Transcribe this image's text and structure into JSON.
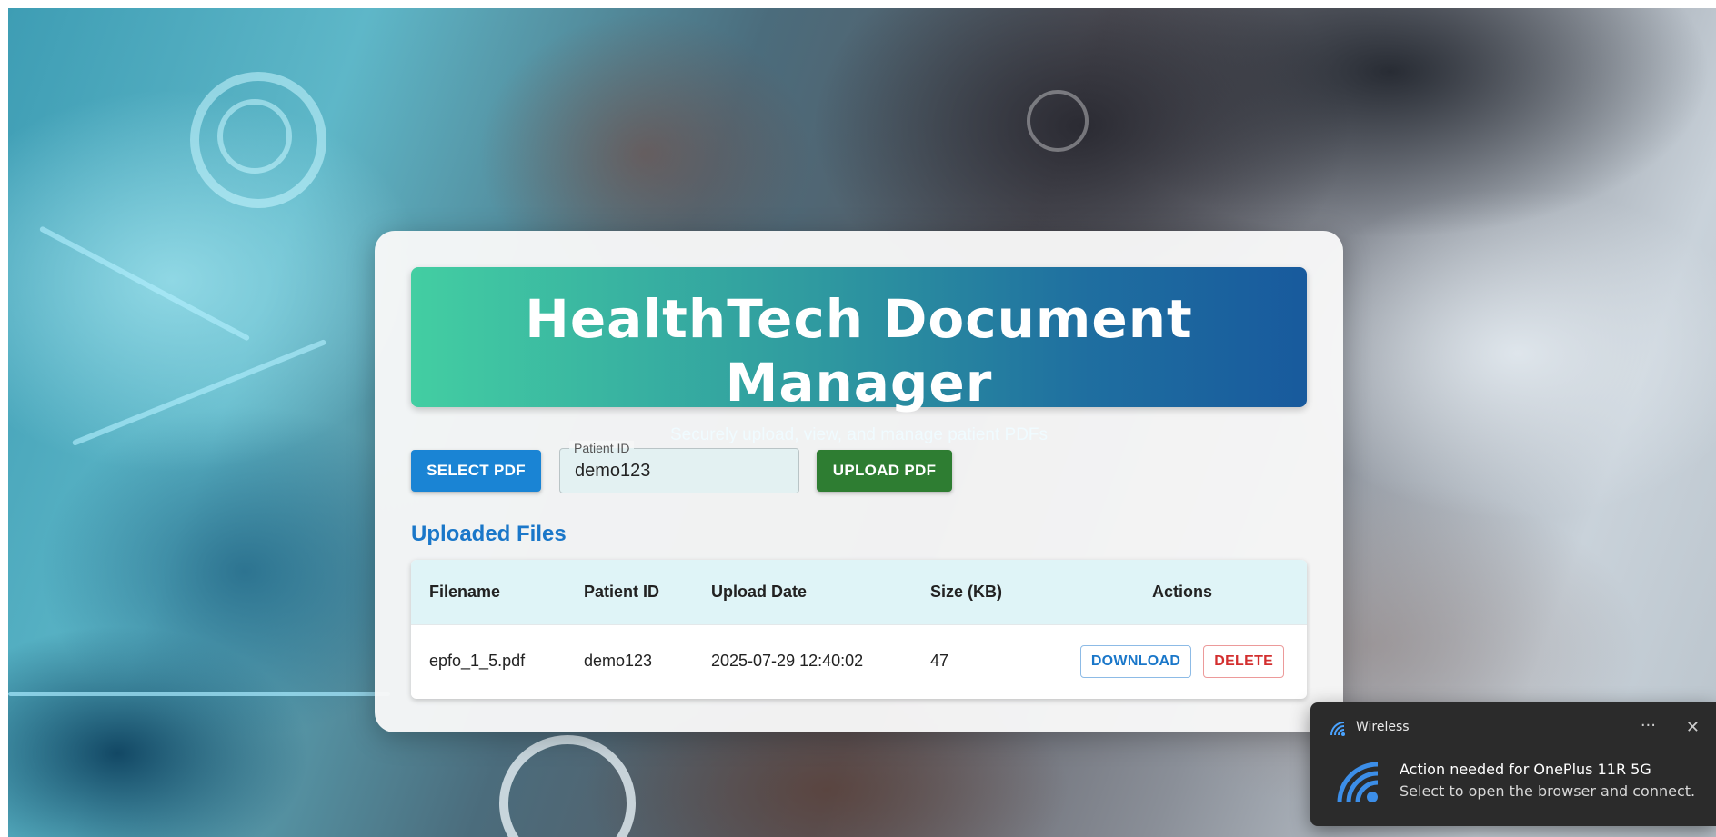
{
  "app": {
    "title": "HealthTech Document Manager",
    "subtitle": "Securely upload, view, and manage patient PDFs"
  },
  "toolbar": {
    "select_label": "SELECT PDF",
    "upload_label": "UPLOAD PDF",
    "patient_id_label": "Patient ID",
    "patient_id_value": "demo123"
  },
  "files": {
    "title": "Uploaded Files",
    "headers": {
      "filename": "Filename",
      "patient_id": "Patient ID",
      "upload_date": "Upload Date",
      "size": "Size (KB)",
      "actions": "Actions"
    },
    "rows": [
      {
        "filename": "epfo_1_5.pdf",
        "patient_id": "demo123",
        "upload_date": "2025-07-29 12:40:02",
        "size": "47",
        "download_label": "DOWNLOAD",
        "delete_label": "DELETE"
      }
    ]
  },
  "notification": {
    "app_name": "Wireless",
    "more_label": "···",
    "close_label": "✕",
    "title": "Action needed for OnePlus 11R 5G",
    "body": "Select to open the browser and connect."
  },
  "colors": {
    "primary": "#1a84d4",
    "success": "#2e7d32",
    "danger": "#d32f2f",
    "section_title": "#1a77c9",
    "hero_gradient_start": "#43cea2",
    "hero_gradient_end": "#185a9d"
  },
  "icons": {
    "wifi": "wifi-icon",
    "more": "more-icon",
    "close": "close-icon"
  }
}
